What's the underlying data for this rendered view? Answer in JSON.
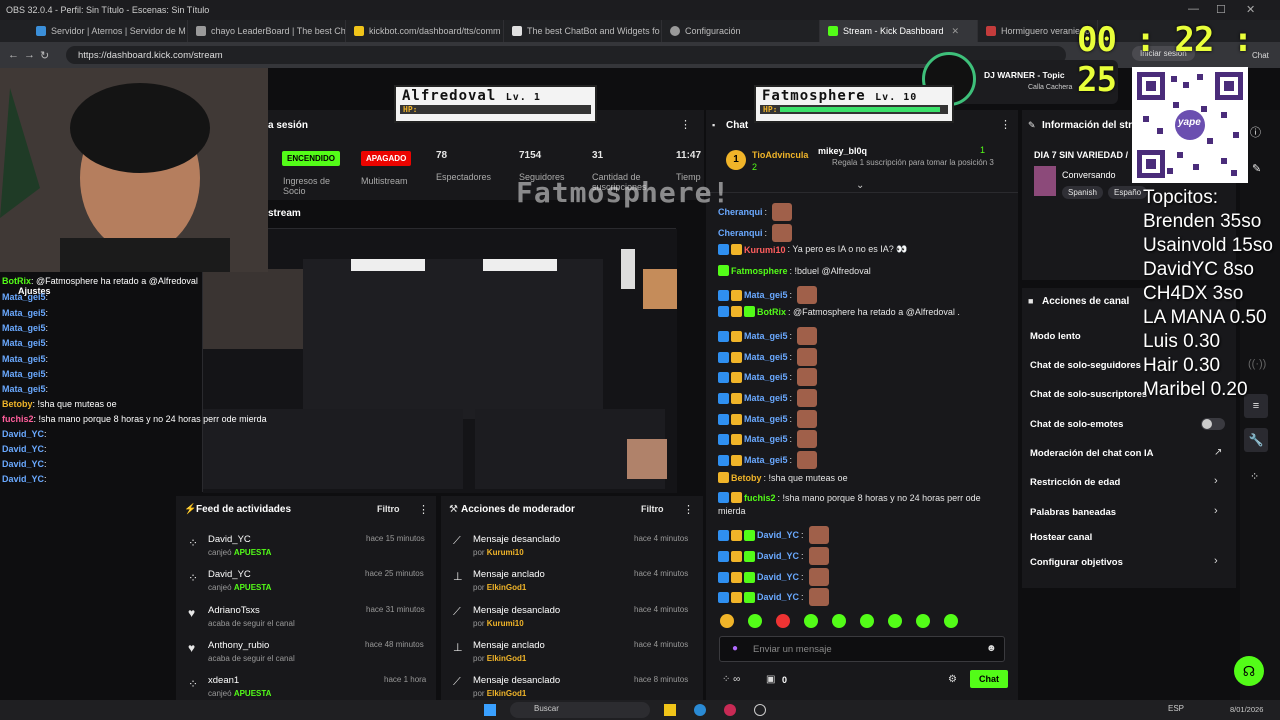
{
  "obs": {
    "title": "OBS 32.0.4 - Perfil: Sin Título - Escenas: Sin Título"
  },
  "tabs": [
    {
      "label": "Servidor | Aternos | Servidor de M",
      "color": "#3b8fd9"
    },
    {
      "label": "chayo LeaderBoard | The best Cha",
      "color": "#9a9a9a"
    },
    {
      "label": "kickbot.com/dashboard/tts/comm",
      "color": "#f0c419"
    },
    {
      "label": "The best ChatBot and Widgets fo",
      "color": "#e0e0e0"
    },
    {
      "label": "Configuración",
      "color": "#9a9a9a"
    },
    {
      "label": "Stream - Kick Dashboard",
      "color": "#53fc18"
    },
    {
      "label": "Hormiguero veraniego",
      "color": "#c43c3c"
    }
  ],
  "address": {
    "url": "https://dashboard.kick.com/stream",
    "login": "Iniciar sesión",
    "chat": "Chat"
  },
  "timer": "00 : 22 : 25",
  "hp_left": {
    "name": "Alfredoval",
    "lv": "Lv. 1",
    "hp": "HP:"
  },
  "hp_right": {
    "name": "Fatmosphere",
    "lv": "Lv. 10",
    "hp": "HP:"
  },
  "banner": "Fatmosphere!",
  "music": {
    "title": "DJ WARNER - Topic",
    "subtitle": "Calla Cachera"
  },
  "session": {
    "title": "a sesión",
    "on": "ENCENDIDO",
    "off": "APAGADO",
    "ingresos": "Ingresos de Socio",
    "multistream": "Multistream",
    "stats": [
      {
        "value": "78",
        "label": "Espectadores"
      },
      {
        "value": "7154",
        "label": "Seguidores"
      },
      {
        "value": "31",
        "label": "Cantidad de suscripciones"
      },
      {
        "value": "11:47",
        "label": "Tiemp"
      }
    ],
    "stream_label": "stream"
  },
  "overlay_chat": {
    "settings": "Ajustes",
    "lines": [
      {
        "user": "BotRix",
        "text": ": @Fatmosphere ha retado a @Alfredoval",
        "color": "#53fc18"
      },
      {
        "user": "Mata_gei5",
        "text": ":",
        "color": "#6aa9ff"
      },
      {
        "user": "Mata_gei5",
        "text": ":",
        "color": "#6aa9ff"
      },
      {
        "user": "Mata_gei5",
        "text": ":",
        "color": "#6aa9ff"
      },
      {
        "user": "Mata_gei5",
        "text": ":",
        "color": "#6aa9ff"
      },
      {
        "user": "Mata_gei5",
        "text": ":",
        "color": "#6aa9ff"
      },
      {
        "user": "Mata_gei5",
        "text": ":",
        "color": "#6aa9ff"
      },
      {
        "user": "Mata_gei5",
        "text": ":",
        "color": "#6aa9ff"
      },
      {
        "user": "Betoby",
        "text": ": !sha que muteas oe",
        "color": "#f0b429"
      },
      {
        "user": "fuchis2",
        "text": ": !sha mano porque 8 horas y no 24 horas perr ode mierda",
        "color": "#ff5e9b"
      },
      {
        "user": "David_YC",
        "text": ":",
        "color": "#6aa9ff"
      },
      {
        "user": "David_YC",
        "text": ":",
        "color": "#6aa9ff"
      },
      {
        "user": "David_YC",
        "text": ":",
        "color": "#6aa9ff"
      },
      {
        "user": "David_YC",
        "text": ":",
        "color": "#6aa9ff"
      }
    ]
  },
  "feed": {
    "title": "Feed de actividades",
    "filter": "Filtro",
    "items": [
      {
        "user": "David_YC",
        "sub": "canjeó",
        "highlight": "APUESTA",
        "time": "hace 15 minutos",
        "icon": "gift-icon"
      },
      {
        "user": "David_YC",
        "sub": "canjeó",
        "highlight": "APUESTA",
        "time": "hace 25 minutos",
        "icon": "gift-icon"
      },
      {
        "user": "AdrianoTsxs",
        "sub": "acaba de seguir el canal",
        "highlight": "",
        "time": "hace 31 minutos",
        "icon": "heart-icon"
      },
      {
        "user": "Anthony_rubio",
        "sub": "acaba de seguir el canal",
        "highlight": "",
        "time": "hace 48 minutos",
        "icon": "heart-icon"
      },
      {
        "user": "xdean1",
        "sub": "canjeó",
        "highlight": "APUESTA",
        "time": "hace 1 hora",
        "icon": "gift-icon"
      }
    ]
  },
  "mod": {
    "title": "Acciones de moderador",
    "filter": "Filtro",
    "items": [
      {
        "action": "Mensaje desanclado",
        "by": "por",
        "user": "Kurumi10",
        "time": "hace 4 minutos",
        "icon": "unpin-icon"
      },
      {
        "action": "Mensaje anclado",
        "by": "por",
        "user": "ElkinGod1",
        "time": "hace 4 minutos",
        "icon": "pin-icon"
      },
      {
        "action": "Mensaje desanclado",
        "by": "por",
        "user": "Kurumi10",
        "time": "hace 4 minutos",
        "icon": "unpin-icon"
      },
      {
        "action": "Mensaje anclado",
        "by": "por",
        "user": "ElkinGod1",
        "time": "hace 4 minutos",
        "icon": "pin-icon"
      },
      {
        "action": "Mensaje desanclado",
        "by": "por",
        "user": "ElkinGod1",
        "time": "hace 8 minutos",
        "icon": "unpin-icon"
      }
    ]
  },
  "chat": {
    "title": "Chat",
    "top1": {
      "user": "TioAdvincula",
      "count": "2"
    },
    "top2": {
      "user": "mikey_bl0q",
      "text": "Regala 1 suscripción para tomar la posición 3",
      "rank": "1"
    },
    "messages": [
      {
        "user": "Cheranqui",
        "text": ":",
        "cls": "uname-blue",
        "emote": true,
        "badges": 0
      },
      {
        "user": "Cheranqui",
        "text": ":",
        "cls": "uname-blue",
        "emote": true,
        "badges": 0
      },
      {
        "user": "Kurumi10",
        "text": ": Ya pero es IA o no es IA? 👀",
        "cls": "uname-red",
        "emote": false,
        "badges": 2
      },
      {
        "user": "Fatmosphere",
        "text": ": !bduel @Alfredoval",
        "cls": "uname-green",
        "emote": false,
        "badges": 1
      },
      {
        "user": "Mata_gei5",
        "text": ":",
        "cls": "uname-blue",
        "emote": true,
        "badges": 2
      },
      {
        "user": "BotRix",
        "text": ": @Fatmosphere ha retado a @Alfredoval .",
        "cls": "uname-green",
        "emote": false,
        "badges": 3
      },
      {
        "user": "Mata_gei5",
        "text": ":",
        "cls": "uname-blue",
        "emote": true,
        "badges": 2
      },
      {
        "user": "Mata_gei5",
        "text": ":",
        "cls": "uname-blue",
        "emote": true,
        "badges": 2
      },
      {
        "user": "Mata_gei5",
        "text": ":",
        "cls": "uname-blue",
        "emote": true,
        "badges": 2
      },
      {
        "user": "Mata_gei5",
        "text": ":",
        "cls": "uname-blue",
        "emote": true,
        "badges": 2
      },
      {
        "user": "Mata_gei5",
        "text": ":",
        "cls": "uname-blue",
        "emote": true,
        "badges": 2
      },
      {
        "user": "Mata_gei5",
        "text": ":",
        "cls": "uname-blue",
        "emote": true,
        "badges": 2
      },
      {
        "user": "Mata_gei5",
        "text": ":",
        "cls": "uname-blue",
        "emote": true,
        "badges": 2
      },
      {
        "user": "Betoby",
        "text": ": !sha que muteas oe",
        "cls": "uname-gold",
        "emote": false,
        "badges": 1
      },
      {
        "user": "fuchis2",
        "text": ": !sha mano porque 8 horas y no 24 horas perr ode",
        "cls": "uname-green",
        "emote": false,
        "badges": 2
      }
    ],
    "wrap_text": "mierda",
    "david": [
      {
        "user": "David_YC",
        "text": ":"
      },
      {
        "user": "David_YC",
        "text": ":"
      },
      {
        "user": "David_YC",
        "text": ":"
      },
      {
        "user": "David_YC",
        "text": ":"
      }
    ],
    "input_placeholder": "Enviar un mensaje",
    "points": "0",
    "send": "Chat"
  },
  "info": {
    "title": "Información del stre",
    "stream_title": "DIA 7 SIN VARIEDAD /",
    "category": "Conversando",
    "tags": [
      "Spanish",
      "Españo"
    ]
  },
  "actions": {
    "title": "Acciones de canal",
    "rows": [
      "Modo lento",
      "Chat de solo-seguidores",
      "Chat de solo-suscriptores",
      "Chat de solo-emotes",
      "Moderación del chat con IA",
      "Restricción de edad",
      "Palabras baneadas",
      "Hostear canal",
      "Configurar objetivos"
    ]
  },
  "topcitos": {
    "title": "Topcitos:",
    "entries": [
      "Brenden 35so",
      "Usainvold 15so",
      "DavidYC 8so",
      "CH4DX 3so",
      "LA MANA 0.50",
      "Luis 0.30",
      "Hair 0.30",
      "Maribel 0.20"
    ]
  },
  "qr_label": "yape",
  "taskbar": {
    "search": "Buscar",
    "lang": "ESP",
    "date": "8/01/2026"
  }
}
